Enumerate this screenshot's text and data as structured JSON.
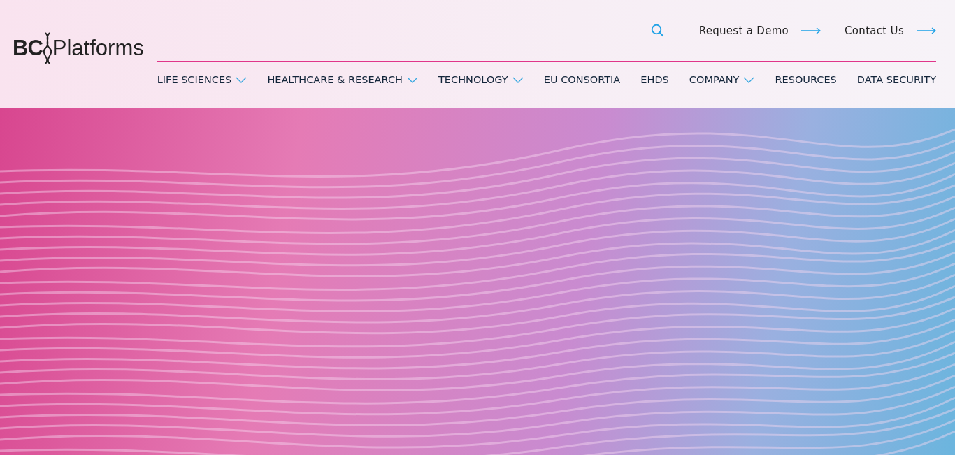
{
  "logo": {
    "left": "BC",
    "right": "Platforms"
  },
  "top_links": [
    {
      "label": "Request a Demo"
    },
    {
      "label": "Contact Us"
    }
  ],
  "nav": [
    {
      "label": "LIFE SCIENCES",
      "dropdown": true
    },
    {
      "label": "HEALTHCARE & RESEARCH",
      "dropdown": true
    },
    {
      "label": "TECHNOLOGY",
      "dropdown": true
    },
    {
      "label": "EU CONSORTIA",
      "dropdown": false
    },
    {
      "label": "EHDS",
      "dropdown": false
    },
    {
      "label": "COMPANY",
      "dropdown": true
    },
    {
      "label": "RESOURCES",
      "dropdown": false
    },
    {
      "label": "DATA SECURITY",
      "dropdown": false
    }
  ]
}
